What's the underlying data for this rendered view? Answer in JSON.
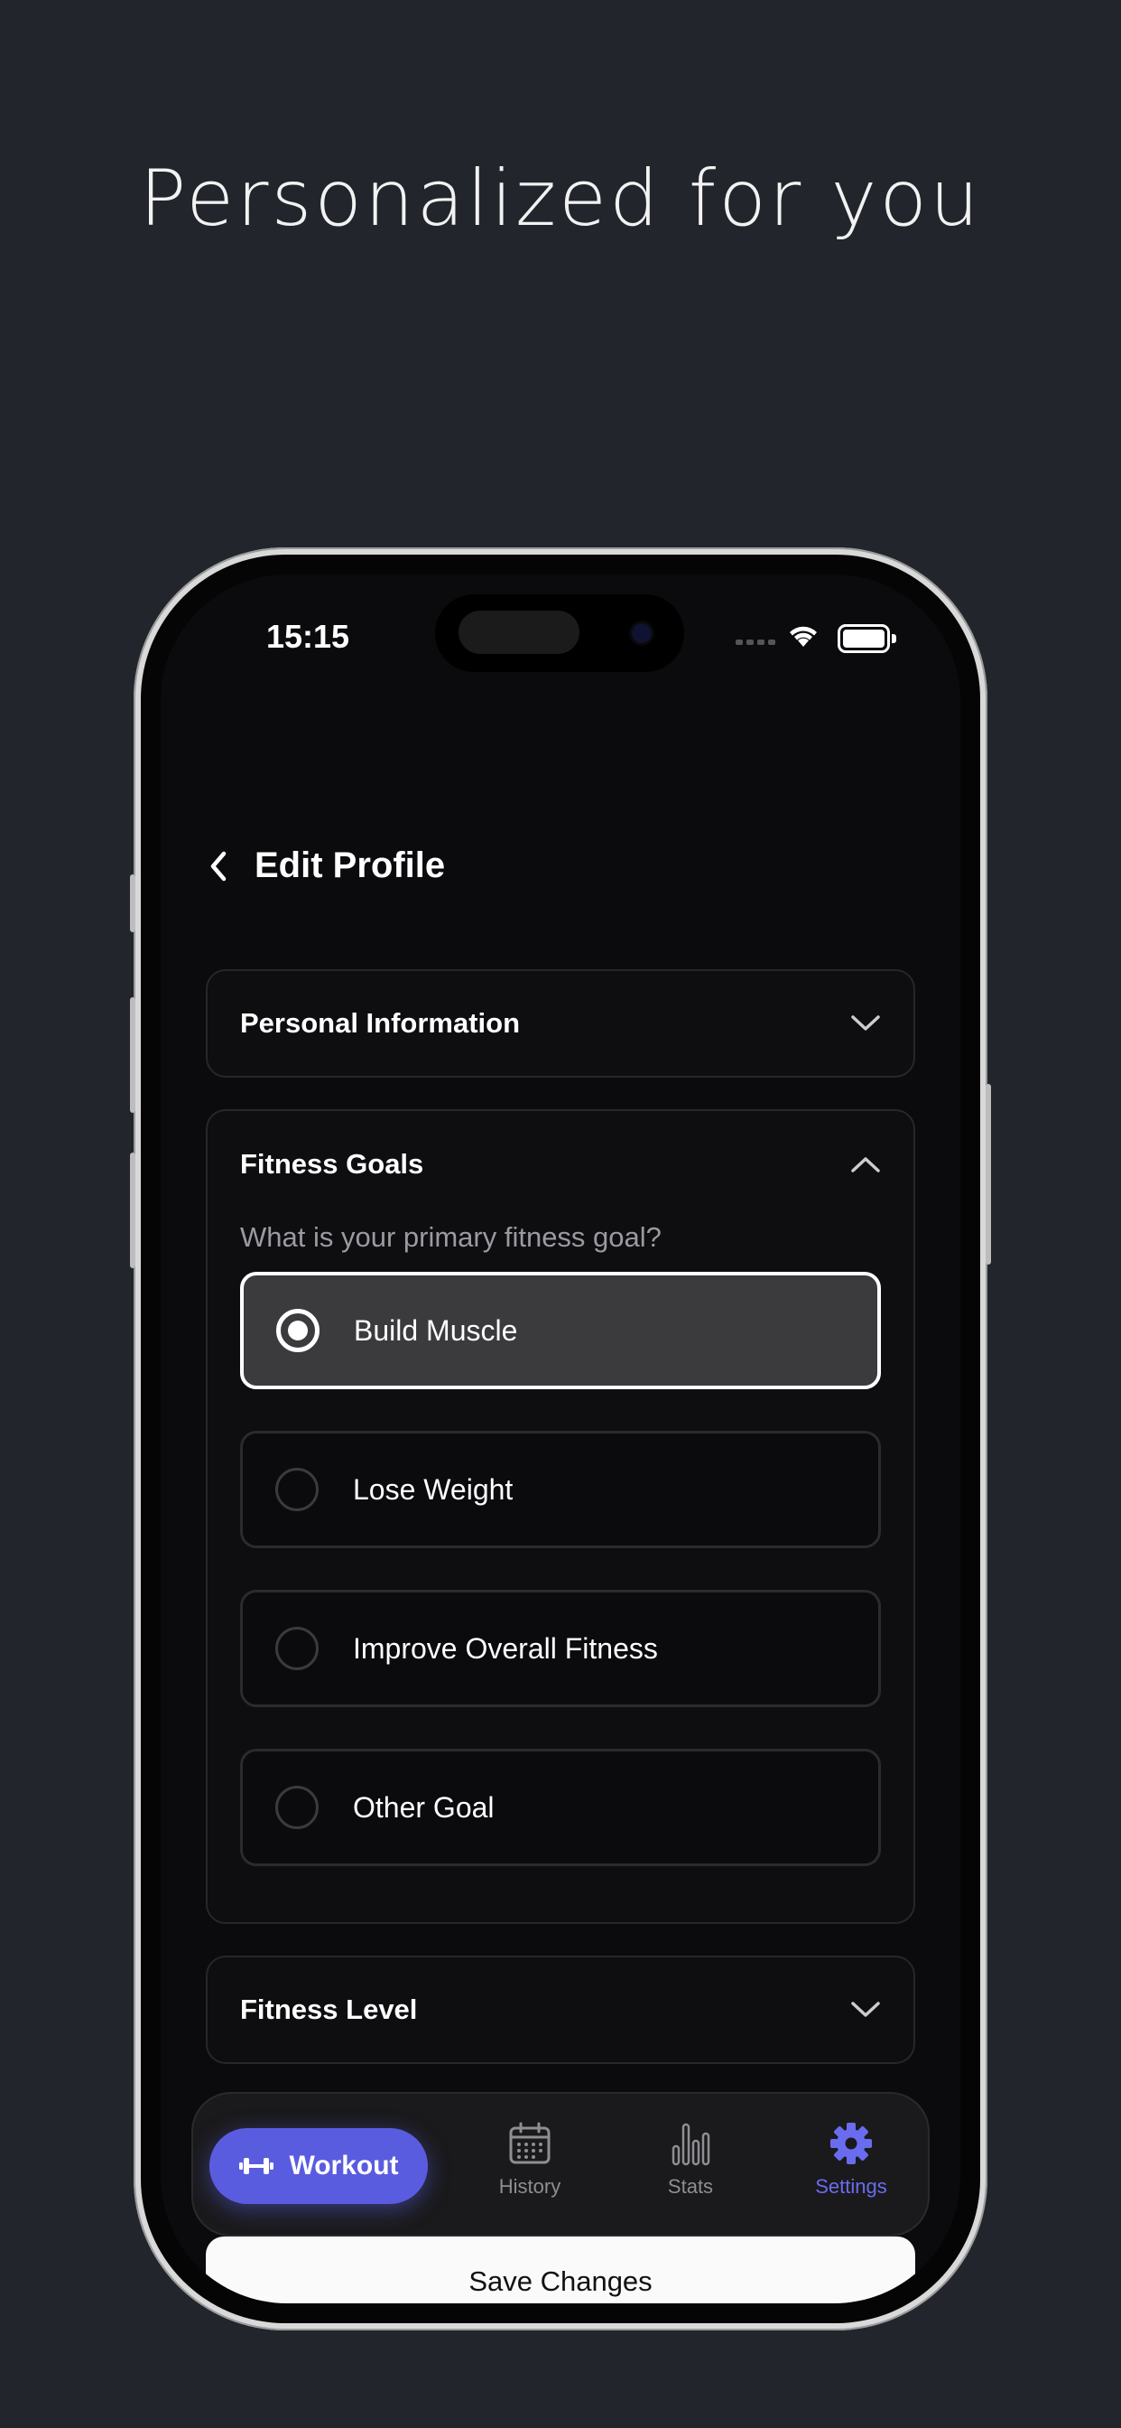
{
  "headline": "Personalized for you",
  "status_bar": {
    "time": "15:15"
  },
  "header": {
    "title": "Edit Profile"
  },
  "sections": {
    "personal": {
      "title": "Personal Information",
      "expanded": false
    },
    "goals": {
      "title": "Fitness Goals",
      "expanded": true,
      "question": "What is your primary fitness goal?",
      "options": [
        {
          "label": "Build Muscle",
          "selected": true
        },
        {
          "label": "Lose Weight",
          "selected": false
        },
        {
          "label": "Improve Overall Fitness",
          "selected": false
        },
        {
          "label": "Other Goal",
          "selected": false
        }
      ]
    },
    "level": {
      "title": "Fitness Level",
      "expanded": false
    }
  },
  "tabbar": {
    "workout": "Workout",
    "history": "History",
    "stats": "Stats",
    "settings": "Settings",
    "active": "Settings"
  },
  "save_button": "Save Changes",
  "colors": {
    "accent": "#5a5ce0",
    "background": "#22252c",
    "screen": "#0b0b0d"
  }
}
